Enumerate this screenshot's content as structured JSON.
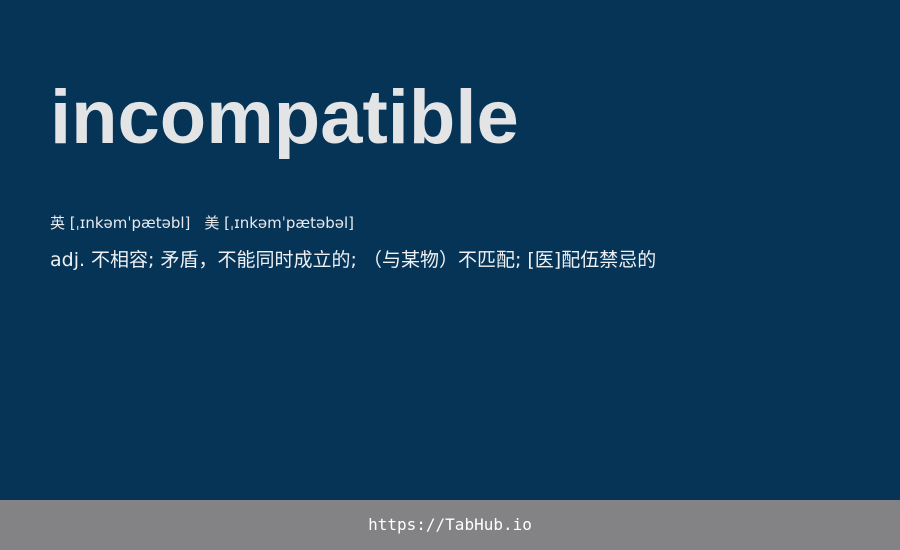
{
  "entry": {
    "word": "incompatible",
    "phonetic_uk": "英 [ˌɪnkəmˈpætəbl]",
    "phonetic_us": "美 [ˌɪnkəmˈpætəbəl]",
    "definition": "adj. 不相容; 矛盾，不能同时成立的; （与某物）不匹配; [医]配伍禁忌的"
  },
  "footer": {
    "url": "https://TabHub.io"
  },
  "colors": {
    "background": "#053457",
    "footer_background": "#838385",
    "text": "#e3e4e6"
  }
}
